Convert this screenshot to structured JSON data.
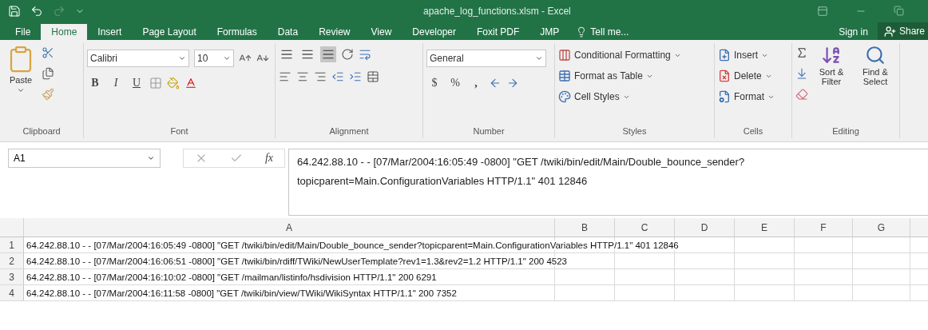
{
  "title_bar": {
    "title": "apache_log_functions.xlsm - Excel",
    "redo_disabled": true
  },
  "menu_tabs": [
    {
      "label": "File",
      "selected": false
    },
    {
      "label": "Home",
      "selected": true
    },
    {
      "label": "Insert",
      "selected": false
    },
    {
      "label": "Page Layout",
      "selected": false
    },
    {
      "label": "Formulas",
      "selected": false
    },
    {
      "label": "Data",
      "selected": false
    },
    {
      "label": "Review",
      "selected": false
    },
    {
      "label": "View",
      "selected": false
    },
    {
      "label": "Developer",
      "selected": false
    },
    {
      "label": "Foxit PDF",
      "selected": false
    },
    {
      "label": "JMP",
      "selected": false
    }
  ],
  "tell_me": "Tell me...",
  "sign_in": "Sign in",
  "share": "Share",
  "ribbon": {
    "clipboard": {
      "label": "Clipboard",
      "paste": "Paste"
    },
    "font": {
      "label": "Font",
      "font_name": "Calibri",
      "font_size": "10",
      "bold": "B",
      "italic": "I",
      "underline": "U"
    },
    "alignment": {
      "label": "Alignment",
      "vertical": [
        {
          "selected": false
        },
        {
          "selected": false
        },
        {
          "selected": true
        }
      ]
    },
    "number": {
      "label": "Number",
      "format": "General",
      "currency": "$",
      "percent": "%",
      "comma": ","
    },
    "styles": {
      "label": "Styles",
      "items": [
        "Conditional Formatting",
        "Format as Table",
        "Cell Styles"
      ]
    },
    "cells": {
      "label": "Cells",
      "items": [
        "Insert",
        "Delete",
        "Format"
      ]
    },
    "editing": {
      "label": "Editing",
      "sort": "Sort & Filter",
      "find": "Find & Select"
    }
  },
  "formula_bar": {
    "name_box": "A1",
    "fx": "fx",
    "value": "64.242.88.10 - - [07/Mar/2004:16:05:49 -0800] \"GET /twiki/bin/edit/Main/Double_bounce_sender?topicparent=Main.ConfigurationVariables HTTP/1.1\" 401 12846"
  },
  "sheet": {
    "columns": [
      "A",
      "B",
      "C",
      "D",
      "E",
      "F",
      "G"
    ],
    "rows": [
      {
        "number": "1",
        "a": "64.242.88.10 - - [07/Mar/2004:16:05:49 -0800] \"GET /twiki/bin/edit/Main/Double_bounce_sender?topicparent=Main.ConfigurationVariables HTTP/1.1\" 401 12846"
      },
      {
        "number": "2",
        "a": "64.242.88.10 - - [07/Mar/2004:16:06:51 -0800] \"GET /twiki/bin/rdiff/TWiki/NewUserTemplate?rev1=1.3&rev2=1.2 HTTP/1.1\" 200 4523"
      },
      {
        "number": "3",
        "a": "64.242.88.10 - - [07/Mar/2004:16:10:02 -0800] \"GET /mailman/listinfo/hsdivision HTTP/1.1\" 200 6291"
      },
      {
        "number": "4",
        "a": "64.242.88.10 - - [07/Mar/2004:16:11:58 -0800] \"GET /twiki/bin/view/TWiki/WikiSyntax HTTP/1.1\" 200 7352"
      }
    ]
  }
}
